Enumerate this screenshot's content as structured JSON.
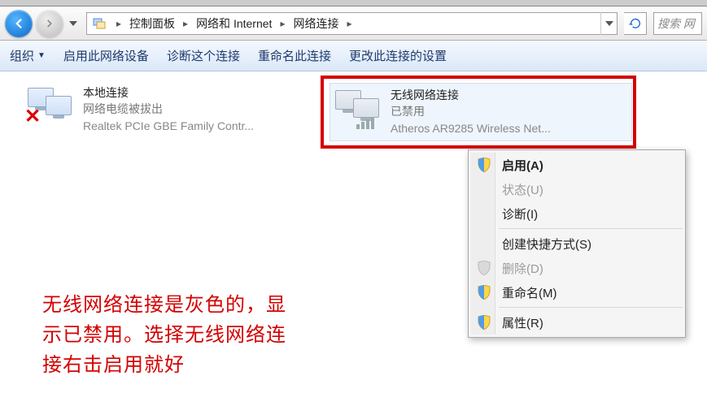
{
  "nav": {
    "crumb1": "控制面板",
    "crumb2": "网络和 Internet",
    "crumb3": "网络连接",
    "search_placeholder": "搜索 网"
  },
  "toolbar": {
    "organize": "组织",
    "enable_device": "启用此网络设备",
    "diagnose": "诊断这个连接",
    "rename": "重命名此连接",
    "change_settings": "更改此连接的设置"
  },
  "connections": {
    "local": {
      "title": "本地连接",
      "status": "网络电缆被拔出",
      "device": "Realtek PCIe GBE Family Contr..."
    },
    "wireless": {
      "title": "无线网络连接",
      "status": "已禁用",
      "device": "Atheros AR9285 Wireless Net..."
    }
  },
  "context_menu": {
    "enable": "启用(A)",
    "status": "状态(U)",
    "diagnose": "诊断(I)",
    "shortcut": "创建快捷方式(S)",
    "delete": "删除(D)",
    "rename": "重命名(M)",
    "properties": "属性(R)"
  },
  "annotation": "无线网络连接是灰色的，显示已禁用。选择无线网络连接右击启用就好"
}
